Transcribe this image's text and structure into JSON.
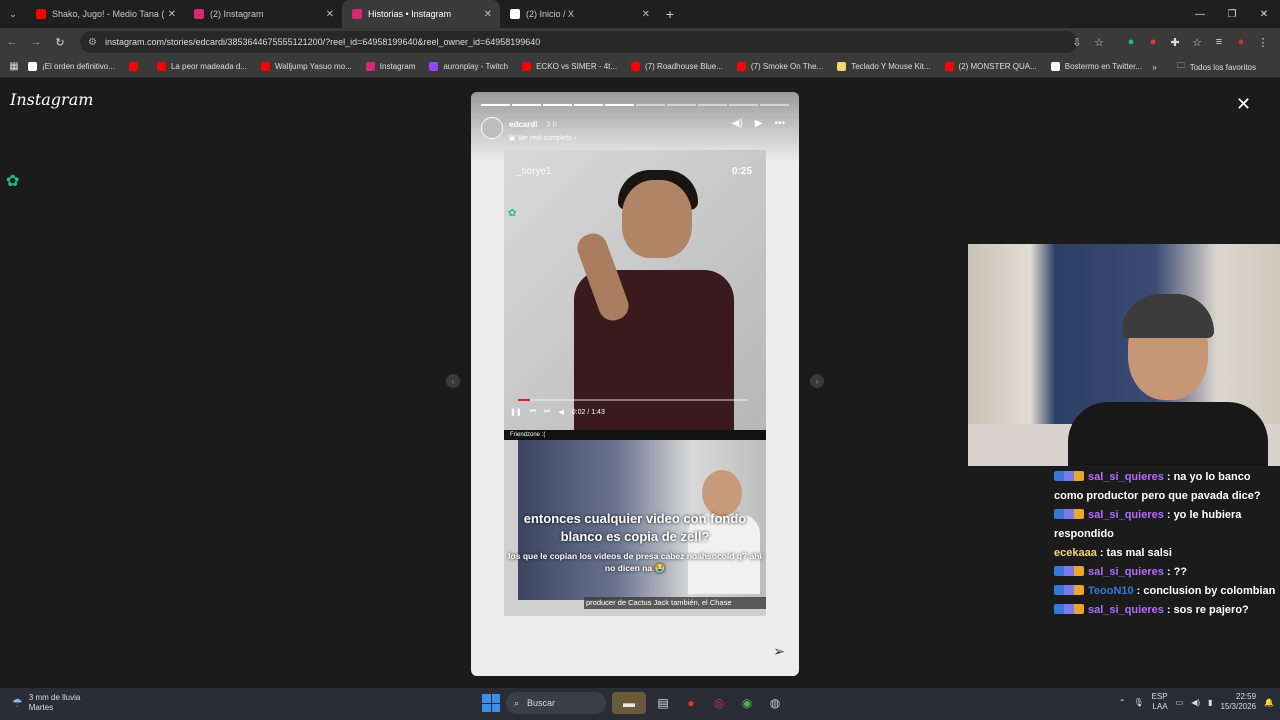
{
  "tabs": [
    {
      "title": "Shako, Jugo! - Medio Tana (Vid",
      "color": "#ff0000"
    },
    {
      "title": "(2) Instagram",
      "color": "#d62976"
    },
    {
      "title": "Historias • Instagram",
      "color": "#d62976",
      "active": true
    },
    {
      "title": "(2) Inicio / X",
      "color": "#ffffff"
    }
  ],
  "address": "instagram.com/stories/edcardi/3853644675555121200/?reel_id=64958199640&reel_owner_id=64958199640",
  "bookmarks": [
    {
      "label": "¡El orden definitivo...",
      "color": "#ffffff"
    },
    {
      "label": "",
      "color": "#ff0000"
    },
    {
      "label": "La peor madeada d...",
      "color": "#ff0000"
    },
    {
      "label": "Walljump Yasuo mo...",
      "color": "#ff0000"
    },
    {
      "label": "Instagram",
      "color": "#d62976"
    },
    {
      "label": "auronplay - Twitch",
      "color": "#9146ff"
    },
    {
      "label": "ECKO vs SIMER - 4t...",
      "color": "#ff0000"
    },
    {
      "label": "(7) Roadhouse Blue...",
      "color": "#ff0000"
    },
    {
      "label": "(7) Smoke On The...",
      "color": "#ff0000"
    },
    {
      "label": "Teclado Y Mouse Kit...",
      "color": "#f5d76e"
    },
    {
      "label": "(2) MONSTER QUA...",
      "color": "#ff0000"
    },
    {
      "label": "Bostermo en Twitter...",
      "color": "#ffffff"
    }
  ],
  "bookmarks_all": "Todos los favoritos",
  "instagram": {
    "logo": "Instagram",
    "story": {
      "username": "edcardi",
      "time": "3 h",
      "reel_link": "Ver reel completo",
      "overlay_user": "_sorye1",
      "overlay_time": "0:25",
      "video_time": "0:02 / 1:43",
      "friendzone": "Friendzone :(",
      "caption_main": "entonces cualquier video con fondo blanco es copia de zell?",
      "caption_sub": "los que le copian los videos de presa cabez noahsocold q? ahi no dicen na 😭",
      "subtitle": "producer de Cactus Jack también, el Chase",
      "segments_total": 10,
      "segments_done": 5
    }
  },
  "chat": [
    {
      "user": "sal_si_quieres",
      "text": ": na yo lo banco como productor pero que pavada dice?",
      "color": "#b36bff",
      "badges": true
    },
    {
      "user": "sal_si_quieres",
      "text": ": yo le hubiera respondido",
      "color": "#b36bff",
      "badges": true
    },
    {
      "user": "ecekaaa",
      "text": ": tas mal salsi",
      "color": "#f5d76e",
      "badges": false
    },
    {
      "user": "sal_si_quieres",
      "text": ": ??",
      "color": "#b36bff",
      "badges": true
    },
    {
      "user": "TeooN10",
      "text": ": conclusion by colombian",
      "color": "#3a78d8",
      "badges": true
    },
    {
      "user": "sal_si_quieres",
      "text": ": sos re pajero?",
      "color": "#b36bff",
      "badges": true
    }
  ],
  "taskbar": {
    "weather_line1": "3 mm de lluvia",
    "weather_line2": "Martes",
    "search": "Buscar",
    "lang1": "ESP",
    "lang2": "LAA",
    "time": "22:59",
    "date": "15/3/2026"
  }
}
